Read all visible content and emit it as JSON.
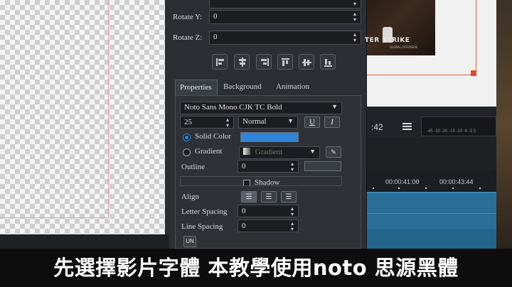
{
  "transform": {
    "rotate_y_label": "Rotate Y:",
    "rotate_y_value": "0",
    "rotate_z_label": "Rotate Z:",
    "rotate_z_value": "0"
  },
  "tabs": [
    {
      "label": "Properties",
      "active": true
    },
    {
      "label": "Background",
      "active": false
    },
    {
      "label": "Animation",
      "active": false
    }
  ],
  "font": {
    "family": "Noto Sans Mono CJK TC Bold",
    "size": "25",
    "style": "Normal",
    "underline_label": "U",
    "italic_label": "I"
  },
  "fill": {
    "solid_label": "Solid Color",
    "solid_selected": true,
    "solid_color": "#2f86d8",
    "gradient_label": "Gradient",
    "gradient_placeholder": "Gradient"
  },
  "outline": {
    "label": "Outline",
    "value": "0"
  },
  "shadow": {
    "label": "Shadow"
  },
  "align": {
    "label": "Align"
  },
  "letter_spacing": {
    "label": "Letter Spacing",
    "value": "0"
  },
  "line_spacing": {
    "label": "Line Spacing",
    "value": "0"
  },
  "un_button": {
    "label": "UN"
  },
  "preview": {
    "logo_text": "TER STRIKE",
    "logo_subtext": "GLOBAL OFFENSIVE"
  },
  "transport": {
    "timecode": ":42",
    "meter_scale": "-45 -30 -20 -15 -10 -6   -3    0"
  },
  "timeline": {
    "ruler": [
      "00:00:41:00",
      "00:00:43:44"
    ]
  },
  "caption": {
    "text": "先選擇影片字體 本教學使用noto 思源黑體"
  },
  "colors": {
    "accent_blue": "#2f86d8",
    "clip_blue": "#2a6f98",
    "safe_guide": "#e8a0a0",
    "frame_handle": "#e24a2a"
  }
}
